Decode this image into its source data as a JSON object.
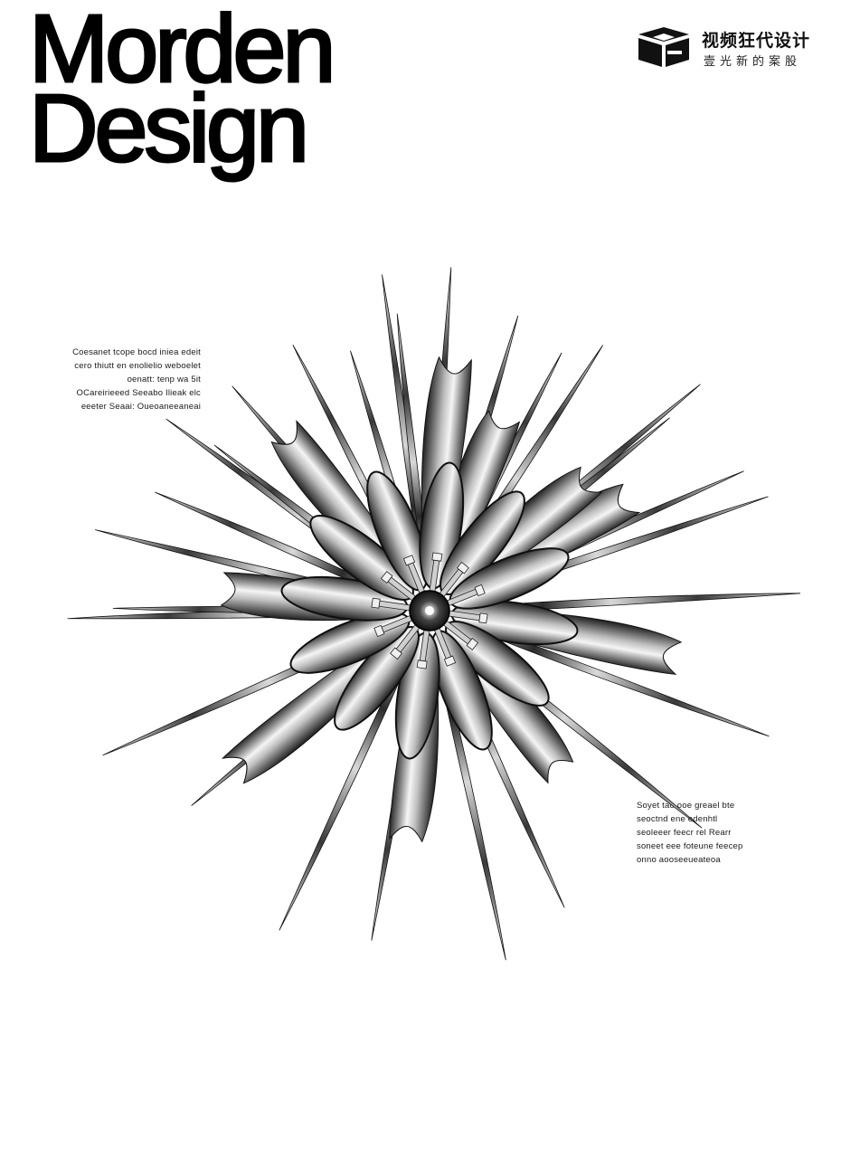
{
  "headline": {
    "line1": "Morden",
    "line2": "Design"
  },
  "logo": {
    "icon": "cube-logo-icon",
    "title": "视频狂代设计",
    "subtitle": "壹光新的案股"
  },
  "notes": {
    "left": [
      "Coesanet tcope bocd iniea edeit",
      "cero thiutt en enolielio weboelet",
      "oenatt: tenp wa 5it",
      "OCareirieeed Seeabo Ilieak elc",
      "eeeter Seaai: Oueoaneeaneai"
    ],
    "right": [
      "Soyet tao ooe greael bte",
      "seoctnd ene edenhtl",
      "seoleeer feecr rel Rearr",
      "soneet eee foteune feecep",
      "onno aooseeueateoa"
    ]
  },
  "colors": {
    "background": "#ffffff",
    "ink": "#000000",
    "metal_dark": "#1c1c1c",
    "metal_mid": "#8a8a8a",
    "metal_light": "#f2f2f2"
  }
}
